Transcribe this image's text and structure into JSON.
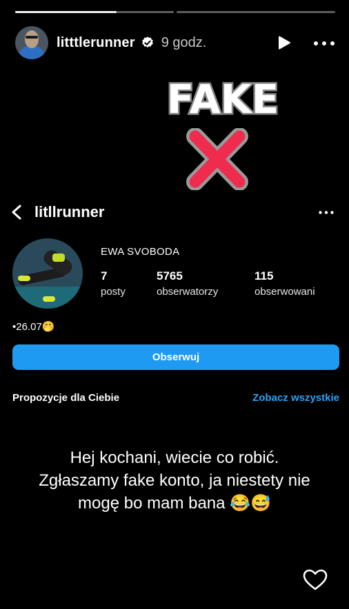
{
  "story": {
    "progress": [
      {
        "fill": 0.64
      },
      {
        "fill": 0
      }
    ],
    "username": "litttlerunner",
    "time_ago": "9 godz."
  },
  "sticker": {
    "text": "FAKE"
  },
  "profile": {
    "handle": "litllrunner",
    "full_name": "EWA SVOBODA",
    "stats": [
      {
        "value": "7",
        "label": "posty"
      },
      {
        "value": "5765",
        "label": "obserwatorzy"
      },
      {
        "value": "115",
        "label": "obserwowani"
      }
    ],
    "bio": "•26.07🤭",
    "follow_label": "Obserwuj",
    "suggestions_label": "Propozycje dla Ciebie",
    "see_all_label": "Zobacz wszystkie",
    "accent_color": "#1f9af3"
  },
  "caption": {
    "lines": [
      "Hej kochani, wiecie co robić.",
      "Zgłaszamy fake konto, ja niestety nie",
      "mogę bo mam bana 😂😅"
    ]
  },
  "icons": [
    "verified-icon",
    "play-icon",
    "more-icon",
    "back-icon",
    "heart-icon"
  ]
}
